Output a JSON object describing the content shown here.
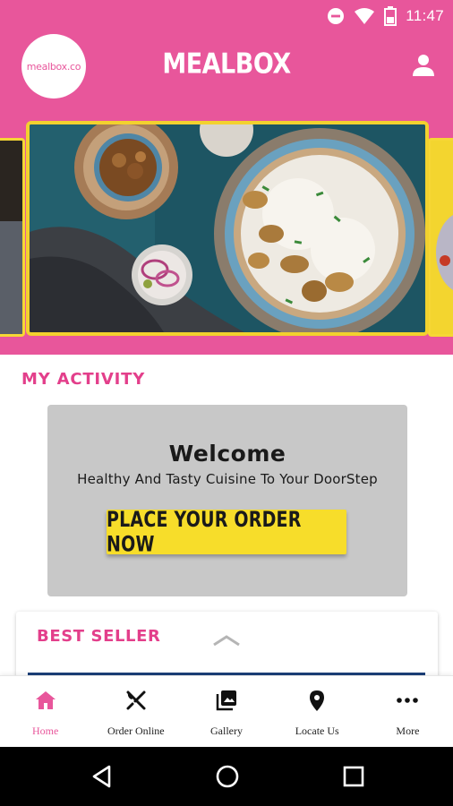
{
  "status_bar": {
    "time": "11:47",
    "icons": [
      "dnd-icon",
      "wifi-icon",
      "battery-icon"
    ]
  },
  "app_bar": {
    "logo_text": "mealbox.co",
    "title": "MEALBOX",
    "profile_icon": "person-icon"
  },
  "hero": {
    "image_alt": "Rice bowl with kebabs"
  },
  "activity": {
    "title": "MY ACTIVITY",
    "welcome_title": "Welcome",
    "welcome_subtitle": "Healthy And Tasty Cuisine To Your DoorStep",
    "order_button": "PLACE YOUR ORDER NOW"
  },
  "best_seller": {
    "title": "BEST SELLER"
  },
  "bottom_nav": {
    "items": [
      {
        "label": "Home",
        "icon": "home-icon",
        "active": true
      },
      {
        "label": "Order Online",
        "icon": "utensils-icon",
        "active": false
      },
      {
        "label": "Gallery",
        "icon": "gallery-icon",
        "active": false
      },
      {
        "label": "Locate Us",
        "icon": "location-pin-icon",
        "active": false
      },
      {
        "label": "More",
        "icon": "more-dots-icon",
        "active": false
      }
    ]
  },
  "colors": {
    "brand_pink": "#e8569b",
    "accent_yellow": "#f7dd2a",
    "section_pink": "#e33f8b"
  }
}
